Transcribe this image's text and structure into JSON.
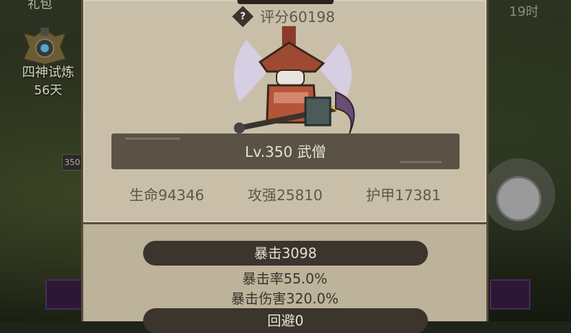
{
  "background": {
    "left_top_label": "礼包",
    "trial": {
      "name": "四神试炼",
      "days": "56天"
    },
    "left_badge": "350",
    "right_time": "19时"
  },
  "panel": {
    "score_label": "评分60198",
    "help_icon": "question-diamond-icon",
    "level_class": "Lv.350 武僧",
    "stats": {
      "hp": "生命94346",
      "attack": "攻强25810",
      "armor": "护甲17381"
    },
    "crit": {
      "title": "暴击3098",
      "rate": "暴击率55.0%",
      "damage": "暴击伤害320.0%"
    },
    "dodge": {
      "title": "回避0"
    }
  },
  "colors": {
    "parchment": "#c9bfa8",
    "dark_bar": "#5a5245",
    "pill": "#3b352d"
  }
}
